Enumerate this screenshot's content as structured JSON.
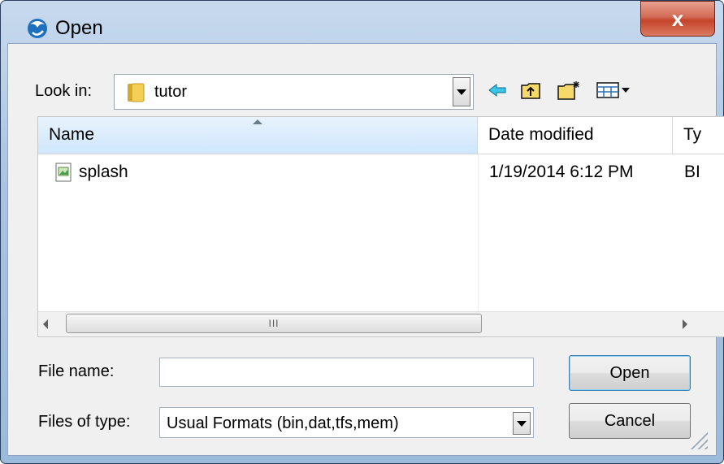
{
  "window": {
    "title": "Open",
    "close_glyph": "x"
  },
  "lookin": {
    "label": "Look in:",
    "value": "tutor",
    "toolbar_icons": [
      "back-arrow-icon",
      "up-folder-icon",
      "new-folder-icon",
      "view-menu-icon"
    ]
  },
  "list": {
    "columns": [
      "Name",
      "Date modified",
      "Ty"
    ],
    "rows": [
      {
        "name": "splash",
        "date": "1/19/2014 6:12 PM",
        "type": "BI"
      }
    ],
    "scroll_thumb": "III"
  },
  "filename": {
    "label": "File name:",
    "value": ""
  },
  "filetype": {
    "label": "Files of type:",
    "value": "Usual Formats (bin,dat,tfs,mem)"
  },
  "buttons": {
    "open": "Open",
    "cancel": "Cancel"
  }
}
